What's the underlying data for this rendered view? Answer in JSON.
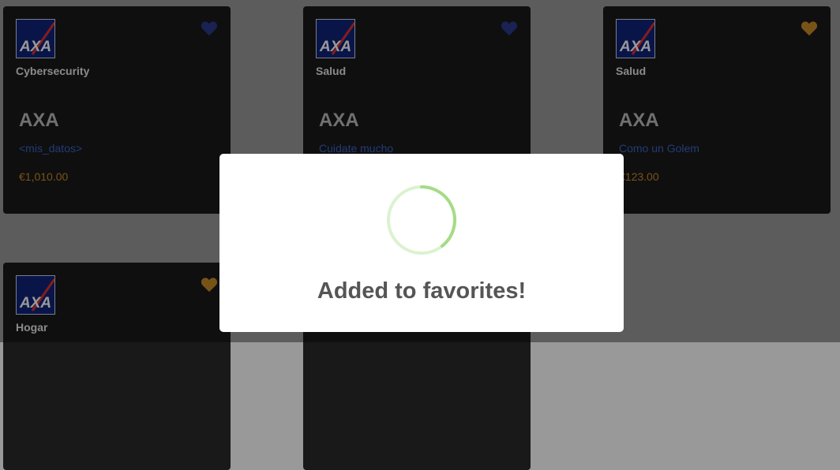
{
  "brand_colors": {
    "heart_blue": "#2b3a8a",
    "heart_gold": "#c98a28",
    "link_blue": "#3a63c9",
    "spinner_green": "#a5dc86"
  },
  "cards": [
    {
      "logo_text": "AXA",
      "category": "Cybersecurity",
      "brand": "AXA",
      "description": "<mis_datos>",
      "price": "€1,010.00",
      "favorite_icon": "heart-icon-blue"
    },
    {
      "logo_text": "AXA",
      "category": "Salud",
      "brand": "AXA",
      "description": "Cuidate mucho",
      "price": "",
      "favorite_icon": "heart-icon-blue"
    },
    {
      "logo_text": "AXA",
      "category": "Salud",
      "brand": "AXA",
      "description": "Como un Golem",
      "price": "€123.00",
      "favorite_icon": "heart-icon-gold"
    },
    {
      "logo_text": "AXA",
      "category": "Hogar",
      "brand": "",
      "description": "",
      "price": "",
      "favorite_icon": "heart-icon-gold"
    },
    {
      "logo_text": "",
      "category": "",
      "brand": "",
      "description": "",
      "price": "",
      "favorite_icon": ""
    }
  ],
  "modal": {
    "title": "Added to favorites!",
    "icon": "success-spinner-icon"
  }
}
